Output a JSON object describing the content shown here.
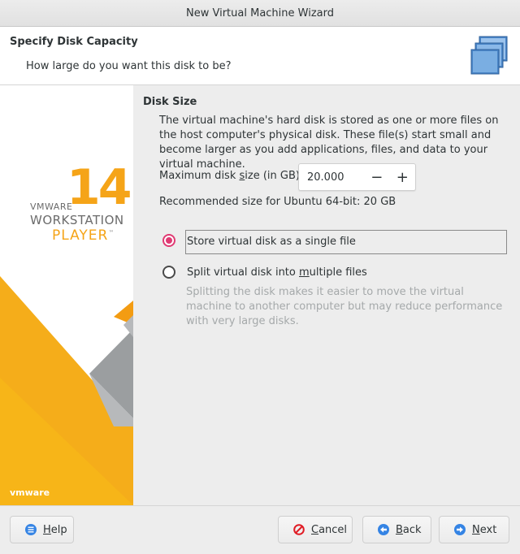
{
  "window": {
    "title": "New Virtual Machine Wizard"
  },
  "header": {
    "title": "Specify Disk Capacity",
    "subtitle": "How large do you want this disk to be?",
    "icon": "disk-stack-icon"
  },
  "banner": {
    "version": "14",
    "brand": "VMWARE",
    "product_line1": "WORKSTATION",
    "product_line2": "PLAYER",
    "trademark": "™",
    "footer_logo": "vmware",
    "accent_color": "#f5a418"
  },
  "main": {
    "section_title": "Disk Size",
    "description": "The virtual machine's hard disk is stored as one or more files on the host computer's physical disk. These file(s) start small and become larger as you add applications, files, and data to your virtual machine.",
    "max_size_label_pre": "Maximum disk ",
    "max_size_label_key": "s",
    "max_size_label_post": "ize (in GB):",
    "max_size_value": "20.000",
    "decrement_symbol": "−",
    "increment_symbol": "+",
    "recommended": "Recommended size for Ubuntu 64-bit: 20 GB",
    "options": [
      {
        "label": "Store virtual disk as a single file",
        "selected": true
      },
      {
        "label_pre": "Split virtual disk into ",
        "label_key": "m",
        "label_post": "ultiple files",
        "selected": false
      }
    ],
    "split_hint": "Splitting the disk makes it easier to move the virtual machine to another computer but may reduce performance with very large disks."
  },
  "footer": {
    "help": {
      "key": "H",
      "rest": "elp",
      "icon": "help-icon"
    },
    "cancel": {
      "key": "C",
      "rest": "ancel",
      "icon": "cancel-icon"
    },
    "back": {
      "key": "B",
      "rest": "ack",
      "icon": "back-arrow-icon"
    },
    "next": {
      "key": "N",
      "rest": "ext",
      "icon": "next-arrow-icon"
    },
    "icon_color": "#3584e4",
    "cancel_color": "#e01b24"
  }
}
